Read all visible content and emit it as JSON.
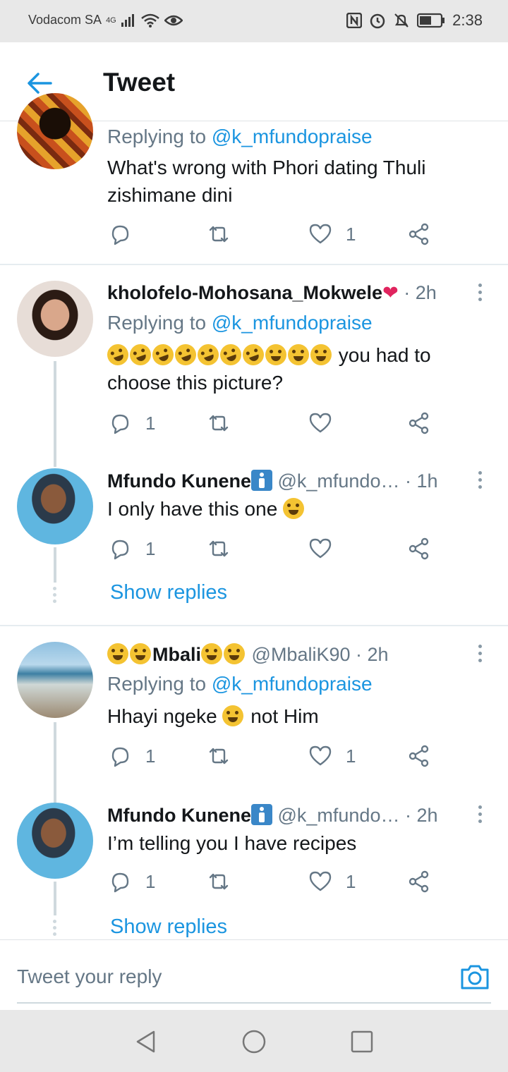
{
  "status_bar": {
    "carrier": "Vodacom SA",
    "network": "4G",
    "time": "2:38"
  },
  "header": {
    "title": "Tweet"
  },
  "tweets": [
    {
      "reply_prefix": "Replying to",
      "reply_to": "@k_mfundopraise",
      "text": "What's wrong with Phori dating Thuli zishimane dini",
      "like_count": "1"
    },
    {
      "name": "kholofelo-Mohosana_Mokwele",
      "time": "· 2h",
      "reply_prefix": "Replying to",
      "reply_to": "@k_mfundopraise",
      "text": "you had to choose this picture?",
      "reply_count": "1"
    },
    {
      "name": "Mfundo Kunene",
      "handle": "@k_mfundo…",
      "time": "· 1h",
      "text": "I only have this one",
      "reply_count": "1",
      "show_replies": "Show replies"
    },
    {
      "name": "Mbali",
      "handle": "@MbaliK90",
      "time": "· 2h",
      "reply_prefix": "Replying to",
      "reply_to": "@k_mfundopraise",
      "text_before": "Hhayi ngeke",
      "text_after": "not Him",
      "reply_count": "1",
      "like_count": "1"
    },
    {
      "name": "Mfundo Kunene",
      "handle": "@k_mfundo…",
      "time": "· 2h",
      "text": "I’m telling you I have recipes",
      "reply_count": "1",
      "like_count": "1",
      "show_replies": "Show replies"
    }
  ],
  "reply_bar": {
    "placeholder": "Tweet your reply"
  },
  "colors": {
    "accent": "#1b95e0",
    "muted": "#657786"
  }
}
